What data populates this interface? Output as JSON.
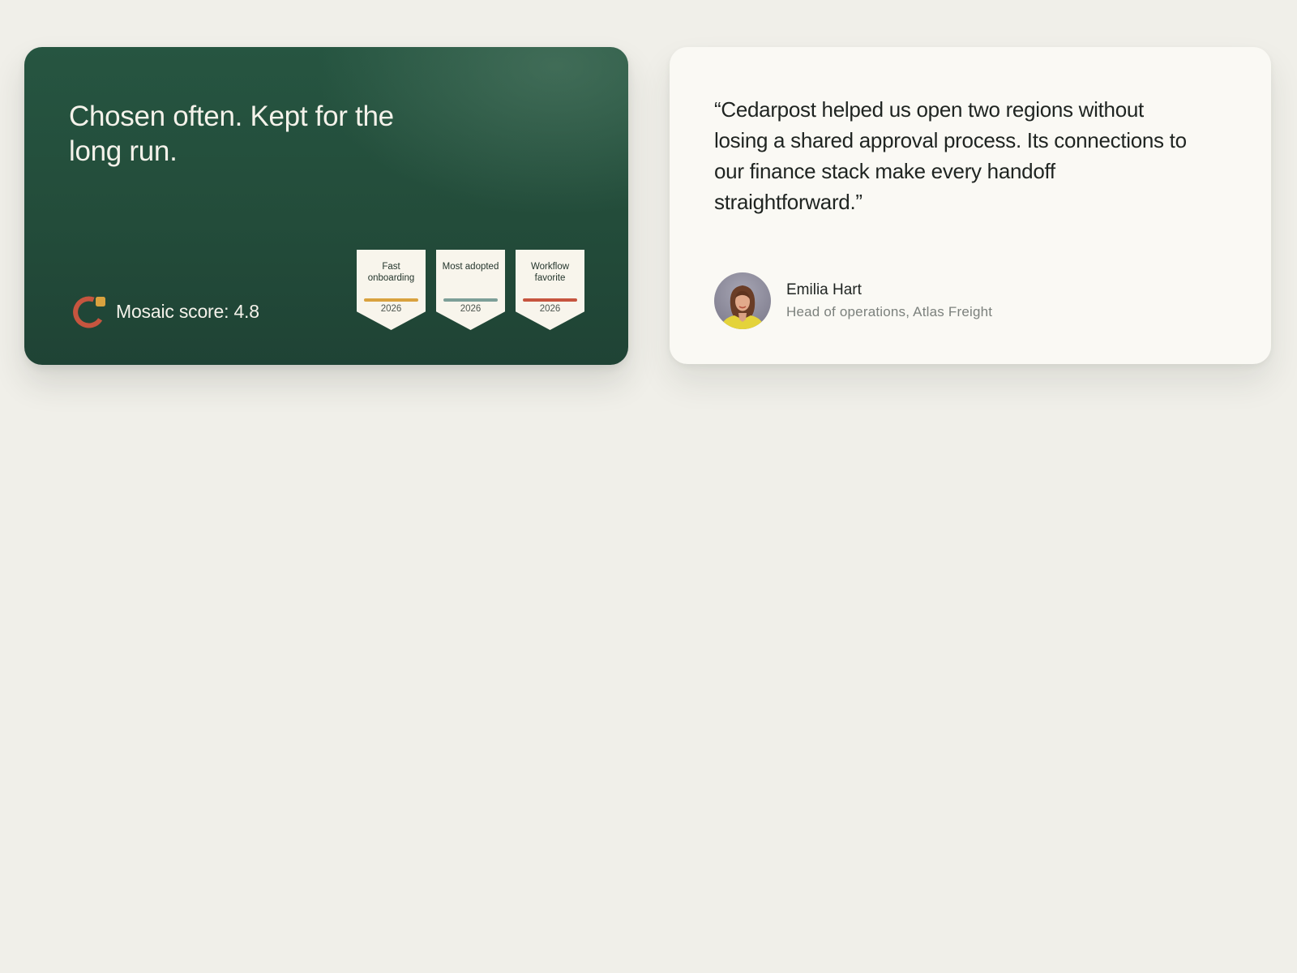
{
  "colors": {
    "page_background": "#f0efe9",
    "dark_card": "#234c3a",
    "light_card": "#faf9f4",
    "logo_arc": "#c6553f",
    "logo_dot": "#d9a23f"
  },
  "awards_card": {
    "headline": "Chosen often. Kept for the long run.",
    "score": {
      "logo_icon": "mosaic-logo-icon",
      "label": "Mosaic score: 4.8"
    },
    "badges": [
      {
        "title": "Fast onboarding",
        "year": "2026",
        "accent": "#d9a23f"
      },
      {
        "title": "Most adopted",
        "year": "2026",
        "accent": "#7d9f98"
      },
      {
        "title": "Workflow favorite",
        "year": "2026",
        "accent": "#c6553f"
      }
    ]
  },
  "testimonial_card": {
    "quote": "“Cedarpost helped us open two regions without losing a shared approval process. Its connections to our finance stack make every handoff straightforward.”",
    "author": {
      "name": "Emilia Hart",
      "role": "Head of operations, Atlas Freight",
      "avatar_icon": "avatar-photo-icon"
    }
  }
}
